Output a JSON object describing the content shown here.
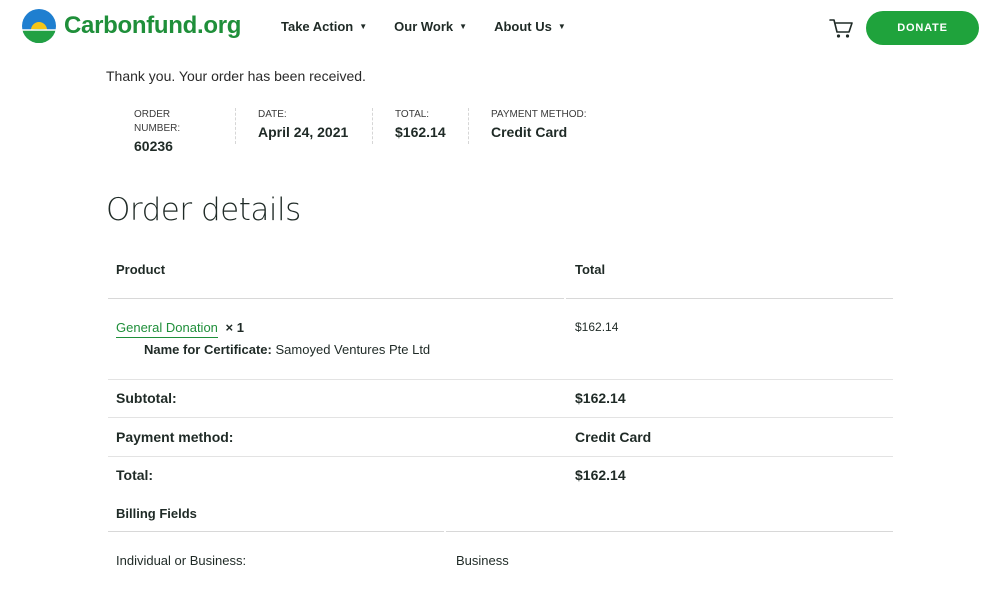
{
  "header": {
    "logo_text": "Carbonfund.org",
    "nav": [
      {
        "label": "Take Action"
      },
      {
        "label": "Our Work"
      },
      {
        "label": "About Us"
      }
    ],
    "caret": "▼",
    "donate_label": "DONATE"
  },
  "thanks": "Thank you. Your order has been received.",
  "overview": [
    {
      "label": "ORDER NUMBER:",
      "value": "60236"
    },
    {
      "label": "DATE:",
      "value": "April 24, 2021"
    },
    {
      "label": "TOTAL:",
      "value": "$162.14"
    },
    {
      "label": "PAYMENT METHOD:",
      "value": "Credit Card"
    }
  ],
  "details": {
    "title": "Order details",
    "col_product": "Product",
    "col_total": "Total",
    "item_name": "General Donation",
    "item_qty": "× 1",
    "meta_label": "Name for Certificate:",
    "meta_value": "Samoyed Ventures Pte Ltd",
    "item_total": "$162.14",
    "subtotal_label": "Subtotal:",
    "subtotal_value": "$162.14",
    "payment_label": "Payment method:",
    "payment_value": "Credit Card",
    "total_label": "Total:",
    "total_value": "$162.14"
  },
  "billing": {
    "title": "Billing Fields",
    "field_label": "Individual or Business:",
    "field_value": "Business"
  },
  "colors": {
    "brand_green": "#1f8f3a",
    "donate_green": "#1fa33c"
  }
}
